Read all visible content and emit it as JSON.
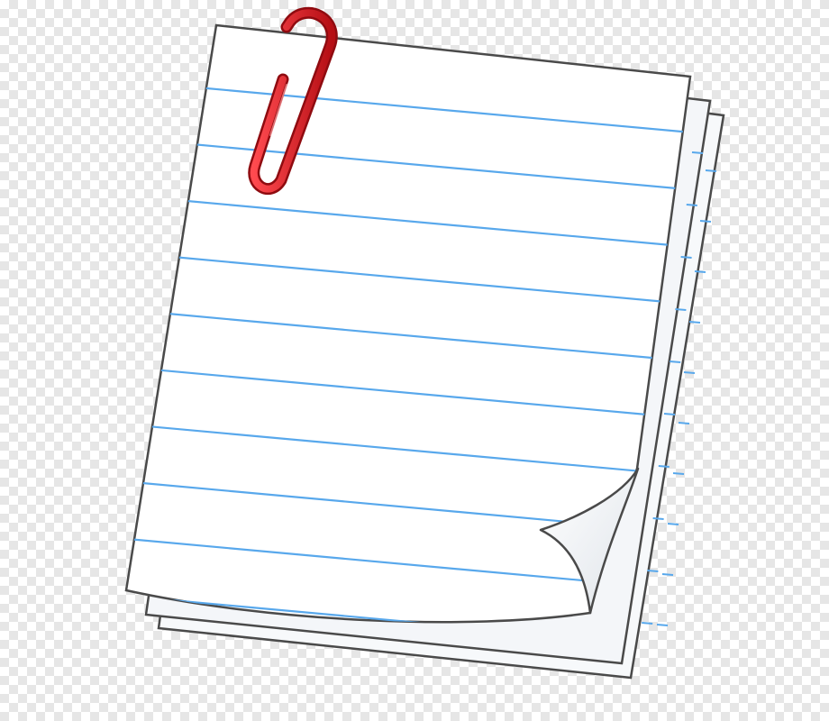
{
  "image": {
    "subject": "paperclip-on-lined-paper-stack",
    "icon": "paperclip-icon",
    "colors": {
      "paper": "#ffffff",
      "paper_shadow": "#e9edf3",
      "outline": "#4a4a4a",
      "rule_lines": "#58a8ec",
      "paperclip": "#e0141b",
      "paperclip_dark": "#a50d12",
      "checkerboard": "#e6e6e6"
    },
    "sheet_count": 3,
    "rule_line_count": 10
  }
}
